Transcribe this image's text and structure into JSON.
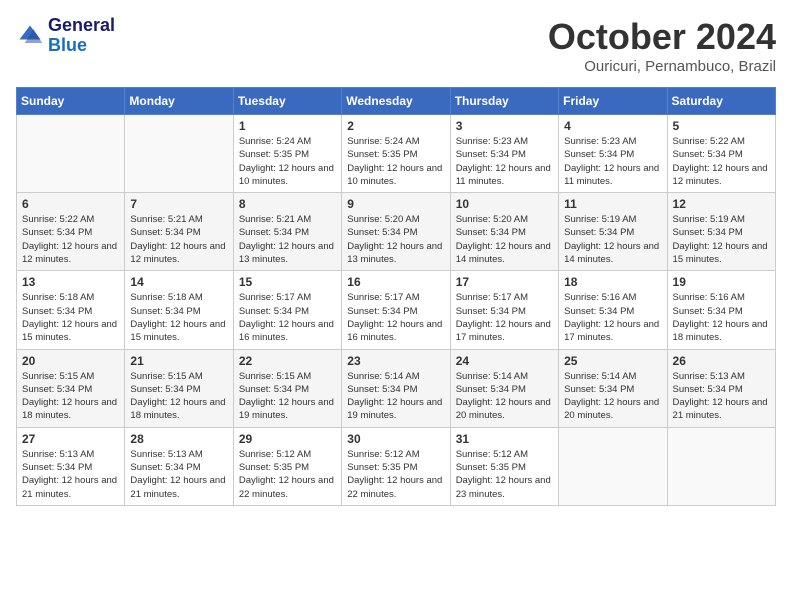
{
  "header": {
    "logo_general": "General",
    "logo_blue": "Blue",
    "month": "October 2024",
    "location": "Ouricuri, Pernambuco, Brazil"
  },
  "weekdays": [
    "Sunday",
    "Monday",
    "Tuesday",
    "Wednesday",
    "Thursday",
    "Friday",
    "Saturday"
  ],
  "weeks": [
    [
      {
        "day": "",
        "sunrise": "",
        "sunset": "",
        "daylight": ""
      },
      {
        "day": "",
        "sunrise": "",
        "sunset": "",
        "daylight": ""
      },
      {
        "day": "1",
        "sunrise": "Sunrise: 5:24 AM",
        "sunset": "Sunset: 5:35 PM",
        "daylight": "Daylight: 12 hours and 10 minutes."
      },
      {
        "day": "2",
        "sunrise": "Sunrise: 5:24 AM",
        "sunset": "Sunset: 5:35 PM",
        "daylight": "Daylight: 12 hours and 10 minutes."
      },
      {
        "day": "3",
        "sunrise": "Sunrise: 5:23 AM",
        "sunset": "Sunset: 5:34 PM",
        "daylight": "Daylight: 12 hours and 11 minutes."
      },
      {
        "day": "4",
        "sunrise": "Sunrise: 5:23 AM",
        "sunset": "Sunset: 5:34 PM",
        "daylight": "Daylight: 12 hours and 11 minutes."
      },
      {
        "day": "5",
        "sunrise": "Sunrise: 5:22 AM",
        "sunset": "Sunset: 5:34 PM",
        "daylight": "Daylight: 12 hours and 12 minutes."
      }
    ],
    [
      {
        "day": "6",
        "sunrise": "Sunrise: 5:22 AM",
        "sunset": "Sunset: 5:34 PM",
        "daylight": "Daylight: 12 hours and 12 minutes."
      },
      {
        "day": "7",
        "sunrise": "Sunrise: 5:21 AM",
        "sunset": "Sunset: 5:34 PM",
        "daylight": "Daylight: 12 hours and 12 minutes."
      },
      {
        "day": "8",
        "sunrise": "Sunrise: 5:21 AM",
        "sunset": "Sunset: 5:34 PM",
        "daylight": "Daylight: 12 hours and 13 minutes."
      },
      {
        "day": "9",
        "sunrise": "Sunrise: 5:20 AM",
        "sunset": "Sunset: 5:34 PM",
        "daylight": "Daylight: 12 hours and 13 minutes."
      },
      {
        "day": "10",
        "sunrise": "Sunrise: 5:20 AM",
        "sunset": "Sunset: 5:34 PM",
        "daylight": "Daylight: 12 hours and 14 minutes."
      },
      {
        "day": "11",
        "sunrise": "Sunrise: 5:19 AM",
        "sunset": "Sunset: 5:34 PM",
        "daylight": "Daylight: 12 hours and 14 minutes."
      },
      {
        "day": "12",
        "sunrise": "Sunrise: 5:19 AM",
        "sunset": "Sunset: 5:34 PM",
        "daylight": "Daylight: 12 hours and 15 minutes."
      }
    ],
    [
      {
        "day": "13",
        "sunrise": "Sunrise: 5:18 AM",
        "sunset": "Sunset: 5:34 PM",
        "daylight": "Daylight: 12 hours and 15 minutes."
      },
      {
        "day": "14",
        "sunrise": "Sunrise: 5:18 AM",
        "sunset": "Sunset: 5:34 PM",
        "daylight": "Daylight: 12 hours and 15 minutes."
      },
      {
        "day": "15",
        "sunrise": "Sunrise: 5:17 AM",
        "sunset": "Sunset: 5:34 PM",
        "daylight": "Daylight: 12 hours and 16 minutes."
      },
      {
        "day": "16",
        "sunrise": "Sunrise: 5:17 AM",
        "sunset": "Sunset: 5:34 PM",
        "daylight": "Daylight: 12 hours and 16 minutes."
      },
      {
        "day": "17",
        "sunrise": "Sunrise: 5:17 AM",
        "sunset": "Sunset: 5:34 PM",
        "daylight": "Daylight: 12 hours and 17 minutes."
      },
      {
        "day": "18",
        "sunrise": "Sunrise: 5:16 AM",
        "sunset": "Sunset: 5:34 PM",
        "daylight": "Daylight: 12 hours and 17 minutes."
      },
      {
        "day": "19",
        "sunrise": "Sunrise: 5:16 AM",
        "sunset": "Sunset: 5:34 PM",
        "daylight": "Daylight: 12 hours and 18 minutes."
      }
    ],
    [
      {
        "day": "20",
        "sunrise": "Sunrise: 5:15 AM",
        "sunset": "Sunset: 5:34 PM",
        "daylight": "Daylight: 12 hours and 18 minutes."
      },
      {
        "day": "21",
        "sunrise": "Sunrise: 5:15 AM",
        "sunset": "Sunset: 5:34 PM",
        "daylight": "Daylight: 12 hours and 18 minutes."
      },
      {
        "day": "22",
        "sunrise": "Sunrise: 5:15 AM",
        "sunset": "Sunset: 5:34 PM",
        "daylight": "Daylight: 12 hours and 19 minutes."
      },
      {
        "day": "23",
        "sunrise": "Sunrise: 5:14 AM",
        "sunset": "Sunset: 5:34 PM",
        "daylight": "Daylight: 12 hours and 19 minutes."
      },
      {
        "day": "24",
        "sunrise": "Sunrise: 5:14 AM",
        "sunset": "Sunset: 5:34 PM",
        "daylight": "Daylight: 12 hours and 20 minutes."
      },
      {
        "day": "25",
        "sunrise": "Sunrise: 5:14 AM",
        "sunset": "Sunset: 5:34 PM",
        "daylight": "Daylight: 12 hours and 20 minutes."
      },
      {
        "day": "26",
        "sunrise": "Sunrise: 5:13 AM",
        "sunset": "Sunset: 5:34 PM",
        "daylight": "Daylight: 12 hours and 21 minutes."
      }
    ],
    [
      {
        "day": "27",
        "sunrise": "Sunrise: 5:13 AM",
        "sunset": "Sunset: 5:34 PM",
        "daylight": "Daylight: 12 hours and 21 minutes."
      },
      {
        "day": "28",
        "sunrise": "Sunrise: 5:13 AM",
        "sunset": "Sunset: 5:34 PM",
        "daylight": "Daylight: 12 hours and 21 minutes."
      },
      {
        "day": "29",
        "sunrise": "Sunrise: 5:12 AM",
        "sunset": "Sunset: 5:35 PM",
        "daylight": "Daylight: 12 hours and 22 minutes."
      },
      {
        "day": "30",
        "sunrise": "Sunrise: 5:12 AM",
        "sunset": "Sunset: 5:35 PM",
        "daylight": "Daylight: 12 hours and 22 minutes."
      },
      {
        "day": "31",
        "sunrise": "Sunrise: 5:12 AM",
        "sunset": "Sunset: 5:35 PM",
        "daylight": "Daylight: 12 hours and 23 minutes."
      },
      {
        "day": "",
        "sunrise": "",
        "sunset": "",
        "daylight": ""
      },
      {
        "day": "",
        "sunrise": "",
        "sunset": "",
        "daylight": ""
      }
    ]
  ]
}
